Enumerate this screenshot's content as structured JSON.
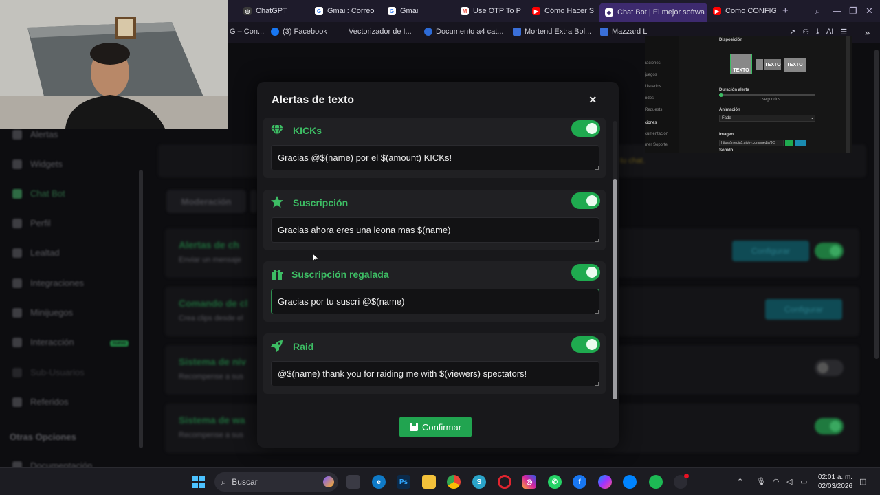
{
  "browser": {
    "tabs": [
      {
        "label": "ChatGPT",
        "color": "#ffffff",
        "fav": "chatgpt-icon"
      },
      {
        "label": "Gmail: Correo",
        "color": "#ffffff",
        "fav": "google-icon"
      },
      {
        "label": "Gmail",
        "color": "#ffffff",
        "fav": "google-icon"
      },
      {
        "label": "Use OTP To P",
        "color": "#ea4335",
        "fav": "gmail-icon"
      },
      {
        "label": "Cómo Hacer S",
        "color": "#ff0000",
        "fav": "youtube-icon"
      },
      {
        "label": "Chat Bot | El mejor softwa",
        "color": "#ffffff",
        "fav": "kick-icon"
      },
      {
        "label": "Como CONFIG",
        "color": "#ff0000",
        "fav": "youtube-icon"
      }
    ],
    "new_tab": "+",
    "bookmarks": [
      {
        "label": "G – Con...",
        "color": "transparent"
      },
      {
        "label": "(3) Facebook",
        "color": "#1877f2"
      },
      {
        "label": "Vectorizador de I...",
        "color": "transparent"
      },
      {
        "label": "Documento a4 cat...",
        "color": "#2d6bd6"
      },
      {
        "label": "Mortend Extra Bol...",
        "color": "#3a6fd8"
      },
      {
        "label": "Mazzard L",
        "color": "#3a6fd8"
      }
    ],
    "ai_label": "AI"
  },
  "background_page": {
    "sidebar": [
      {
        "label": "Alertas"
      },
      {
        "label": "Widgets"
      },
      {
        "label": "Chat Bot"
      },
      {
        "label": "Perfil"
      },
      {
        "label": "Lealtad"
      },
      {
        "label": "Integraciones"
      },
      {
        "label": "Minijuegos"
      },
      {
        "label": "Interacción"
      },
      {
        "label": "Sub-Usuarios"
      },
      {
        "label": "Referidos"
      },
      {
        "label": "Otras Opciones"
      },
      {
        "label": "Documentación"
      }
    ],
    "new_badge": "nuevo",
    "tab_label": "Moderación",
    "banner_text": "tu chat.",
    "sections": [
      {
        "title": "Alertas de ch",
        "subtitle": "Enviar un mensaje",
        "button": "Configurar"
      },
      {
        "title": "Comando de cl",
        "subtitle": "Crea clips desde el",
        "button": "Configurar"
      },
      {
        "title": "Sistema de niv",
        "subtitle": "Recompense a sus"
      },
      {
        "title": "Sistema de wa",
        "subtitle": "Recompense a sus"
      }
    ]
  },
  "preview": {
    "section": "Disposición",
    "texto": "TEXTO",
    "duration_label": "Duración alerta",
    "duration_value": "1 segundos",
    "animation_label": "Animación",
    "animation_value": "Fade",
    "image_label": "Imagen",
    "image_url": "https://media1.giphy.com/media/3Cl",
    "sound_label": "Sonido",
    "side_items": [
      "raciones",
      "juegos",
      "Usuarios",
      "ridos",
      "Requests",
      "ciones",
      "cumentación",
      "mer Soporte"
    ]
  },
  "modal": {
    "title": "Alertas de texto",
    "close": "×",
    "alerts": [
      {
        "label": "KICKs",
        "icon": "gem-icon",
        "message": "Gracias  @$(name) por el  $(amount) KICKs!",
        "enabled": true
      },
      {
        "label": "Suscripción",
        "icon": "star-icon",
        "message": "Gracias ahora eres una leona mas $(name)",
        "enabled": true
      },
      {
        "label": "Suscripción regalada",
        "icon": "gift-icon",
        "message": "Gracias por tu suscri @$(name)",
        "enabled": true
      },
      {
        "label": "Raid",
        "icon": "rocket-icon",
        "message": "@$(name) thank you for raiding me with $(viewers) spectators!",
        "enabled": true
      }
    ],
    "confirm": "Confirmar",
    "accent": "#3dbd64"
  },
  "taskbar": {
    "search": "Buscar",
    "time": "02:01 a. m.",
    "date": "02/03/2026"
  }
}
